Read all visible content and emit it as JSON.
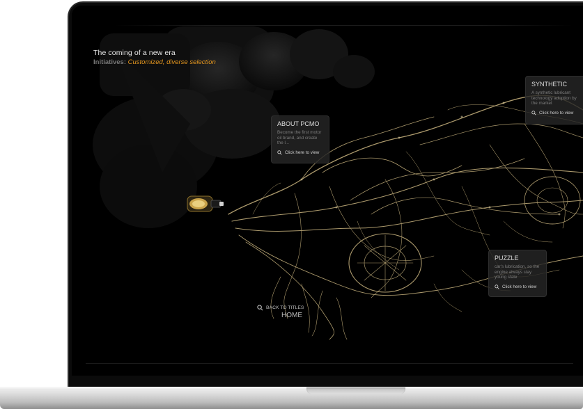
{
  "hero": {
    "headline": "The coming of a new era",
    "initiatives_label": "Initiatives:",
    "initiatives_value": "Customized, diverse selection"
  },
  "cards": {
    "about": {
      "title": "ABOUT PCMO",
      "text": "Become the first motor oil brand, and create the l...",
      "link": "Click here to view"
    },
    "synthetic": {
      "title": "SYNTHETIC",
      "text": "A synthetic lubricant technology adoption by the market",
      "link": "Click here to view"
    },
    "puzzle": {
      "title": "PUZZLE",
      "text": "car's lubrication, so the engine always stay young state",
      "link": "Click here to view"
    }
  },
  "navigation": {
    "back_label": "BACK TO TITLES",
    "home_label": "HOME"
  },
  "icons": {
    "link_icon": "magnifier-icon",
    "back_icon": "magnifier-icon",
    "product_icon": "oil-bottle-icon"
  },
  "colors": {
    "background": "#000000",
    "accent": "#e3961f",
    "root_gold": "#c9b47f",
    "card_bg": "#262626"
  }
}
